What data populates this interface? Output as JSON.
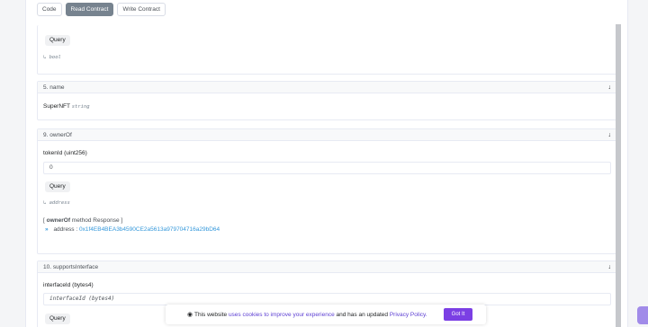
{
  "tabs": [
    {
      "label": "Code"
    },
    {
      "label": "Read Contract"
    },
    {
      "label": "Write Contract"
    }
  ],
  "panel_top": {
    "query_label": "Query",
    "return_type": "↳ bool"
  },
  "panel_name": {
    "header": "5. name",
    "value": "SuperNFT",
    "type": "string"
  },
  "panel_owner": {
    "header": "9. ownerOf",
    "param_label": "tokenId (uint256)",
    "input_value": "0",
    "query_label": "Query",
    "return_type": "↳ address",
    "response_header_open": "[ ",
    "response_method": "ownerOf",
    "response_header_close": " method Response ]",
    "response_prefix": "»",
    "response_key": "address :",
    "response_value": "0x1f4EB4BEA3b4590CE2a5613a979704716a29bD64"
  },
  "panel_supports": {
    "header": "10. supportsInterface",
    "param_label": "interfaceId (bytes4)",
    "input_placeholder": "interfaceId (bytes4)",
    "query_label": "Query"
  },
  "cookie": {
    "prefix": "This website",
    "link1": "uses cookies to improve your experience",
    "middle": "and has an updated",
    "link2": "Privacy Policy.",
    "button": "Got It"
  },
  "colors": {
    "accent": "#7b3fe4",
    "link": "#3498db"
  }
}
